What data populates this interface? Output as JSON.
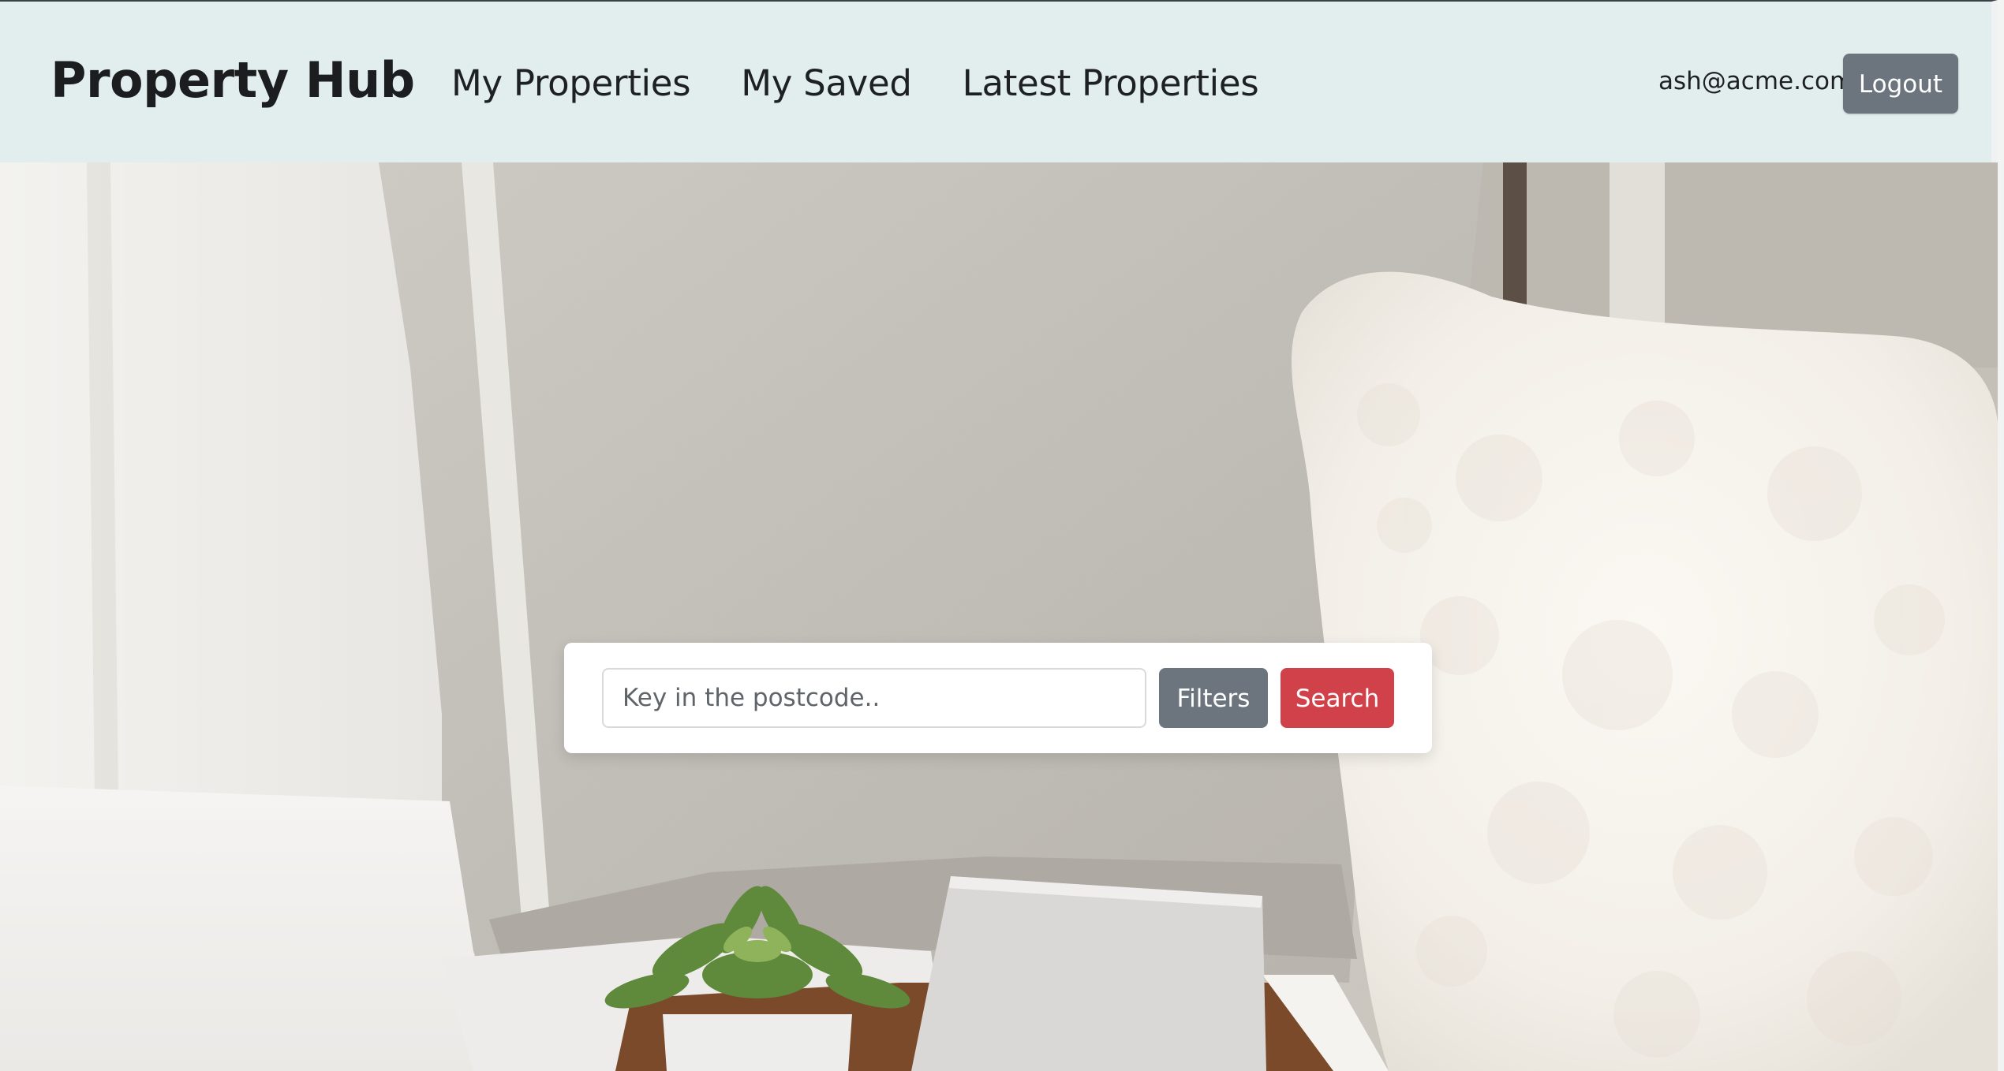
{
  "navbar": {
    "brand": "Property Hub",
    "links": [
      {
        "label": "My Properties"
      },
      {
        "label": "My Saved"
      },
      {
        "label": "Latest Properties"
      }
    ],
    "user_email": "ash@acme.com",
    "logout_label": "Logout"
  },
  "search": {
    "placeholder": "Key in the postcode..",
    "value": "",
    "filters_label": "Filters",
    "search_label": "Search"
  },
  "colors": {
    "navbar_bg": "#e2eeed",
    "secondary_button": "#6c757d",
    "danger_button": "#d0414a",
    "text": "#1e2124"
  },
  "hero": {
    "image": "bedroom-pillows-photo"
  }
}
